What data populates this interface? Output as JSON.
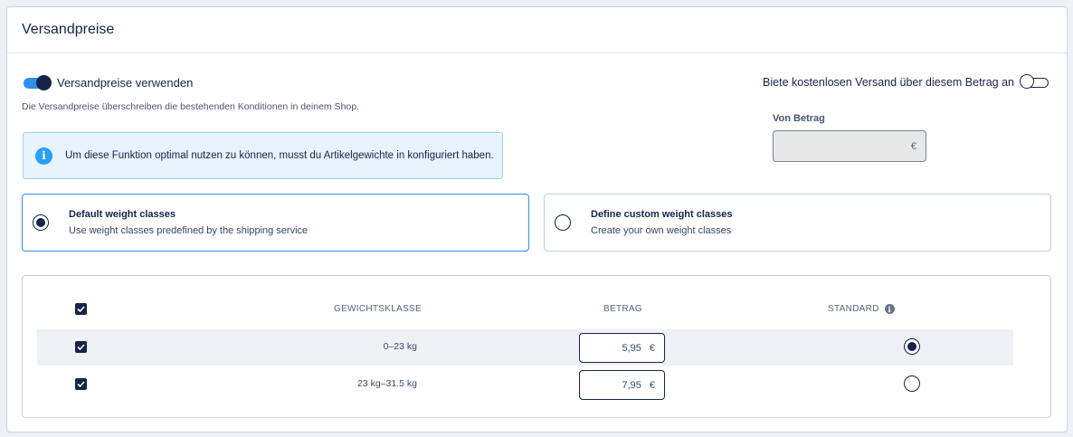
{
  "header": {
    "title": "Versandpreise"
  },
  "use_toggle": {
    "label": "Versandpreise verwenden",
    "state": "on"
  },
  "description": "Die Versandpreise überschreiben die bestehenden Konditionen in deinem Shop.",
  "info": {
    "text": "Um diese Funktion optimal nutzen zu können, musst du Artikelgewichte in konfiguriert haben.",
    "icon": "info-icon"
  },
  "free_shipping": {
    "label": "Biete kostenlosen Versand über diesem Betrag an",
    "state": "off"
  },
  "von_betrag": {
    "label": "Von Betrag",
    "value": "",
    "currency": "€"
  },
  "weight_choice": {
    "default": {
      "title": "Default weight classes",
      "subtitle": "Use weight classes predefined by the shipping service",
      "selected": true
    },
    "custom": {
      "title": "Define custom weight classes",
      "subtitle": "Create your own weight classes",
      "selected": false
    }
  },
  "table": {
    "headers": {
      "weight": "GEWICHTSKLASSE",
      "amount": "BETRAG",
      "standard": "STANDARD"
    },
    "rows": [
      {
        "weight": "0–23 kg",
        "amount": "5,95",
        "currency": "€",
        "checked": true,
        "standard": true
      },
      {
        "weight": "23 kg–31.5 kg",
        "amount": "7,95",
        "currency": "€",
        "checked": true,
        "standard": false
      }
    ]
  },
  "colors": {
    "accent": "#2f8fe8",
    "navy": "#16234a",
    "info_bg": "#e7f3fd"
  }
}
